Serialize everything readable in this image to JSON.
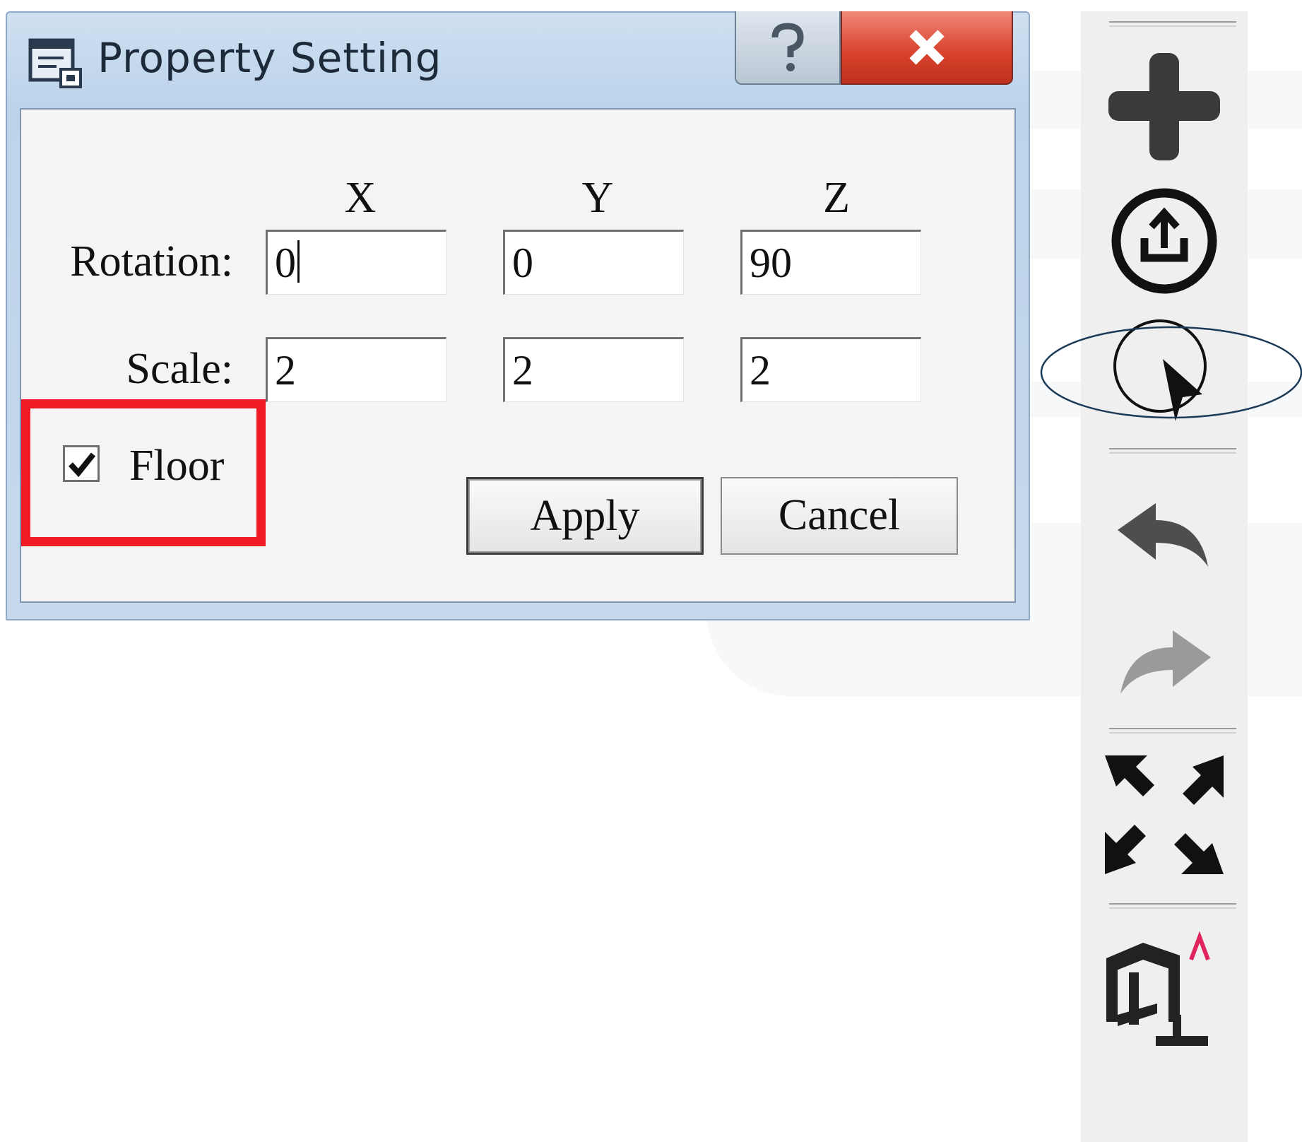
{
  "dialog": {
    "title": "Property Setting",
    "columns": [
      "X",
      "Y",
      "Z"
    ],
    "rotation": {
      "label": "Rotation:",
      "x": "0",
      "y": "0",
      "z": "90"
    },
    "scale": {
      "label": "Scale:",
      "x": "2",
      "y": "2",
      "z": "2"
    },
    "floor": {
      "label": "Floor",
      "checked": true
    },
    "apply_label": "Apply",
    "cancel_label": "Cancel",
    "help_icon": "question-icon",
    "close_icon": "close-icon"
  },
  "toolbar": {
    "tools": [
      "add-icon",
      "export-icon",
      "select-pointer-icon",
      "undo-icon",
      "redo-icon",
      "fit-view-icon",
      "room-layout-icon"
    ]
  },
  "colors": {
    "highlight_box": "#ee1b24",
    "annotation_ellipse": "#1b3a57",
    "close_button": "#d9442f",
    "caret_accent": "#e0245e"
  }
}
